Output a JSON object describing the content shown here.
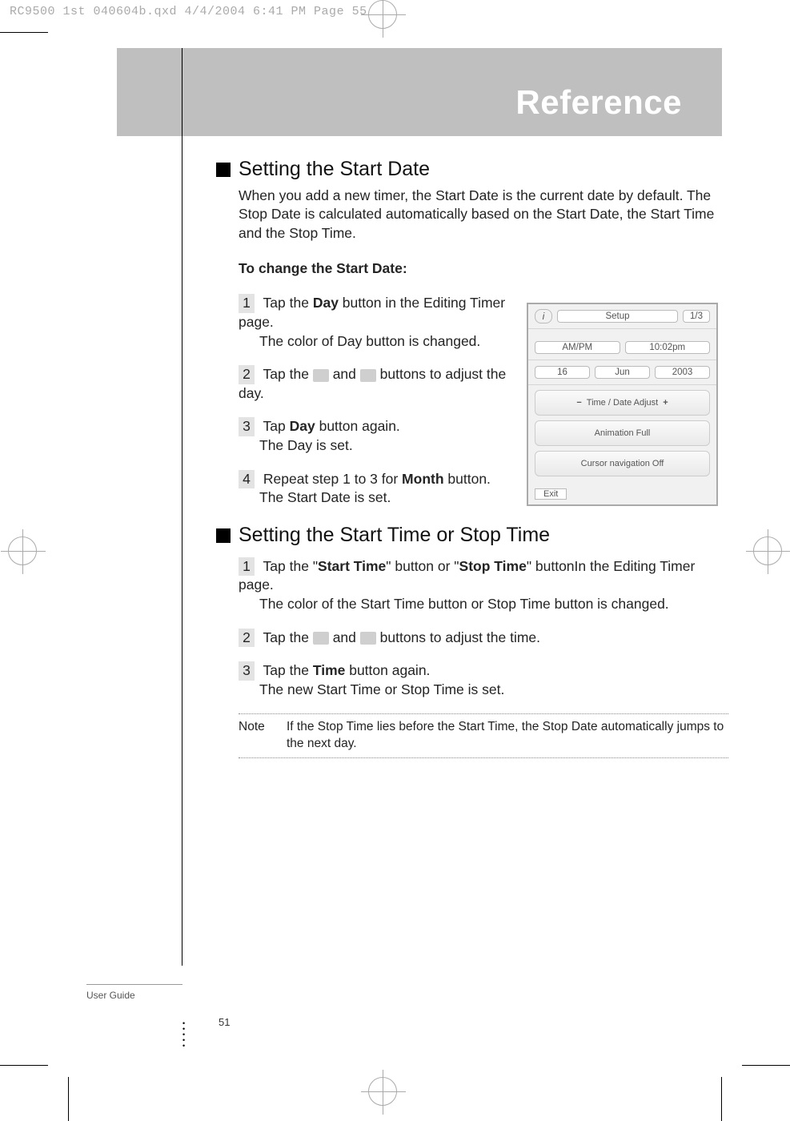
{
  "meta": {
    "file_header": "RC9500 1st 040604b.qxd  4/4/2004  6:41 PM  Page 55"
  },
  "hero": {
    "title": "Reference"
  },
  "section1": {
    "heading": "Setting the Start Date",
    "intro": "When you add a new timer, the Start Date is the current date by default. The Stop Date is calculated automatically based on the Start Date, the Start Time and the Stop Time.",
    "sub": "To change the Start Date:",
    "steps": [
      {
        "n": "1",
        "l1a": "Tap the ",
        "l1b": "Day",
        "l1c": " button in the Editing Timer page.",
        "l2": "The color of Day button is changed."
      },
      {
        "n": "2",
        "l1a": "Tap the ",
        "l1c": " buttons to adjust the day.",
        "mid": " and "
      },
      {
        "n": "3",
        "l1a": "Tap ",
        "l1b": "Day",
        "l1c": " button again.",
        "l2": "The Day is set."
      },
      {
        "n": "4",
        "l1a": "Repeat step 1 to 3 for ",
        "l1b": "Month",
        "l1c": " button.",
        "l2": "The Start Date is set."
      }
    ]
  },
  "device": {
    "title": "Setup",
    "page": "1/3",
    "ampm": "AM/PM",
    "time": "10:02pm",
    "day": "16",
    "mon": "Jun",
    "year": "2003",
    "adj": "Time / Date Adjust",
    "anim": "Animation Full",
    "cursor": "Cursor navigation Off",
    "exit": "Exit"
  },
  "section2": {
    "heading": "Setting the Start Time or Stop Time",
    "steps": [
      {
        "n": "1",
        "line": "Tap the \"",
        "b1": "Start Time",
        "mid1": "\" button or \"",
        "b2": "Stop Time",
        "mid2": "\" buttonIn the Editing Timer page.",
        "l2": "The color of the Start Time button or Stop Time button is changed."
      },
      {
        "n": "2",
        "l1a": "Tap the ",
        "mid": " and ",
        "l1c": " buttons to adjust the time."
      },
      {
        "n": "3",
        "l1a": "Tap the ",
        "l1b": "Time",
        "l1c": " button again.",
        "l2": "The new Start Time or Stop Time is set."
      }
    ],
    "note_label": "Note",
    "note_text": "If the Stop Time lies before the Start Time, the Stop Date automatically jumps to the next day."
  },
  "footer": {
    "label": "User Guide",
    "page": "51"
  }
}
